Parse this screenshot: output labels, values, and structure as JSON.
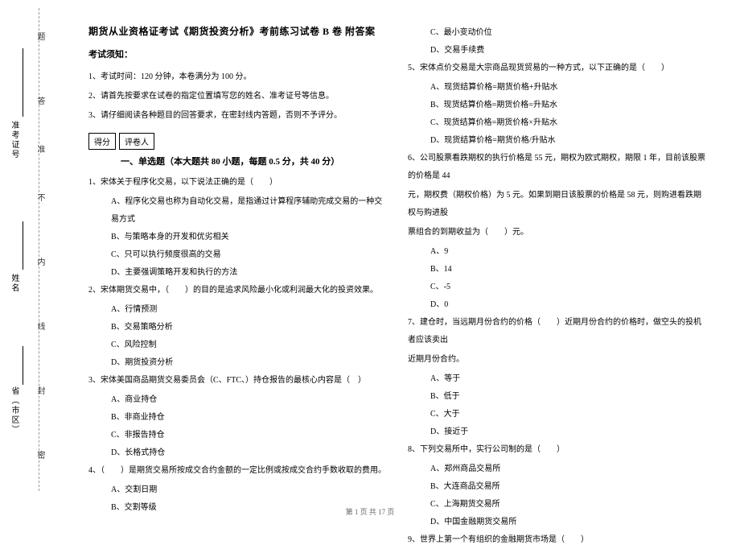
{
  "binding": {
    "labels": [
      "密",
      "封",
      "线",
      "内",
      "不",
      "准",
      "答",
      "题"
    ]
  },
  "vfields": {
    "province": "省（市区）",
    "name": "姓名",
    "ticket": "准考证号"
  },
  "header": {
    "title": "期货从业资格证考试《期货投资分析》考前练习试卷 B 卷  附答案"
  },
  "notice": {
    "title": "考试须知：",
    "items": [
      "1、考试时间：120 分钟，本卷满分为 100 分。",
      "2、请首先按要求在试卷的指定位置填写您的姓名、准考证号等信息。",
      "3、请仔细阅读各种题目的回答要求，在密封线内答题，否则不予评分。"
    ]
  },
  "score": {
    "label1": "得分",
    "label2": "评卷人"
  },
  "section1": {
    "title": "一、单选题（本大题共 80 小题，每题 0.5 分，共 40 分）"
  },
  "q1": {
    "stem": "1、宋体关于程序化交易，以下说法正确的是（　　）",
    "a": "A、程序化交易也称为自动化交易，是指通过计算程序辅助完成交易的一种交易方式",
    "b": "B、与策略本身的开发和优劣相关",
    "c": "C、只可以执行频度很高的交易",
    "d": "D、主要强调策略开发和执行的方法"
  },
  "q2": {
    "stem": "2、宋体期货交易中，（　　）的目的是追求风险最小化或利润最大化的投资效果。",
    "a": "A、行情预测",
    "b": "B、交易策略分析",
    "c": "C、风险控制",
    "d": "D、期货投资分析"
  },
  "q3": {
    "stem": "3、宋体美国商品期货交易委员会（C、FTC、）持仓报告的最核心内容是（　）",
    "a": "A、商业持仓",
    "b": "B、非商业持仓",
    "c": "C、非报告持仓",
    "d": "D、长格式持仓"
  },
  "q4": {
    "stem": "4、（　　）是期货交易所按成交合约金额的一定比例或按成交合约手数收取的费用。",
    "a": "A、交割日期",
    "b": "B、交割等级",
    "c": "C、最小变动价位",
    "d": "D、交易手续费"
  },
  "q5": {
    "stem": "5、宋体点价交易是大宗商品现货贸易的一种方式，以下正确的是（　　）",
    "a": "A、现货结算价格=期货价格+升贴水",
    "b": "B、现货结算价格=期货价格=升贴水",
    "c": "C、现货结算价格=期货价格×升贴水",
    "d": "D、现货结算价格=期货价格/升贴水"
  },
  "q6": {
    "stem1": "6、公司股票看跌期权的执行价格是 55 元，期权为欧式期权，期限 1 年，目前该股票的价格是 44",
    "stem2": "元，期权费（期权价格）为 5 元。如果到期日该股票的价格是 58 元，则购进看跌期权与购进股",
    "stem3": "票组合的到期收益为（　　）元。",
    "a": "A、9",
    "b": "B、14",
    "c": "C、-5",
    "d": "D、0"
  },
  "q7": {
    "stem1": "7、建仓时，当远期月份合约的价格（　　）近期月份合约的价格时，做空头的投机者应该卖出",
    "stem2": "近期月份合约。",
    "a": "A、等于",
    "b": "B、低于",
    "c": "C、大于",
    "d": "D、接近于"
  },
  "q8": {
    "stem": "8、下列交易所中，实行公司制的是（　　）",
    "a": "A、郑州商品交易所",
    "b": "B、大连商品交易所",
    "c": "C、上海期货交易所",
    "d": "D、中国金融期货交易所"
  },
  "q9": {
    "stem": "9、世界上第一个有组织的金融期货市场是（　　）"
  },
  "footer": {
    "text": "第 1 页 共 17 页"
  }
}
